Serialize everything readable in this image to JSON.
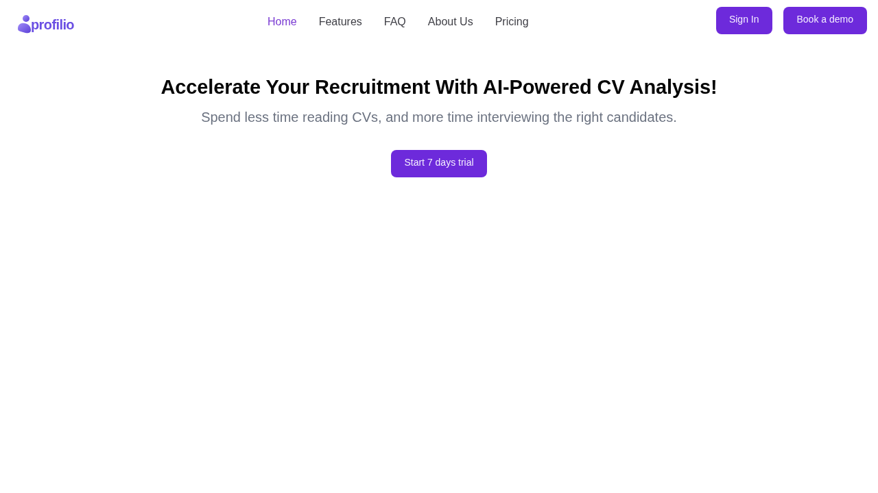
{
  "header": {
    "logo": {
      "wordmark": "profilio"
    },
    "nav": [
      {
        "label": "Home",
        "selected": true
      },
      {
        "label": "Features",
        "selected": false
      },
      {
        "label": "FAQ",
        "selected": false
      },
      {
        "label": "About Us",
        "selected": false
      },
      {
        "label": "Pricing",
        "selected": false
      }
    ],
    "buttons": [
      "Sign In",
      "Book a demo"
    ]
  },
  "hero": {
    "title": "Accelerate Your Recruitment With AI-Powered CV Analysis!",
    "subtitle": "Spend less time reading CVs, and more time interviewing the right candidates.",
    "cta": "Start 7 days trial"
  }
}
